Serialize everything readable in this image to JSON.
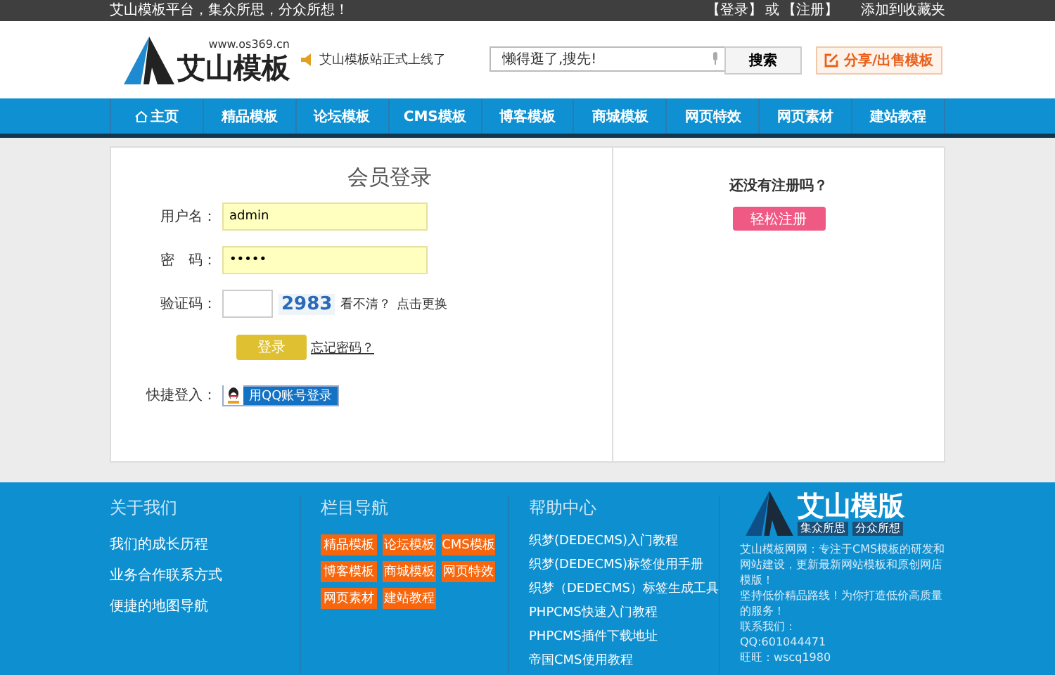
{
  "top_bar": {
    "slogan": "艾山模板平台，集众所思，分众所想！",
    "login": "【登录】",
    "or": "或",
    "register": "【注册】",
    "favorite": "添加到收藏夹"
  },
  "header": {
    "logo_text": "艾山模板",
    "logo_url": "www.os369.cn",
    "notice": "艾山模板站正式上线了",
    "search": {
      "value": "懒得逛了,搜先!",
      "button": "搜索"
    },
    "share_button": "分享/出售模板"
  },
  "nav": [
    {
      "label": "主页",
      "kind": "home"
    },
    {
      "label": "精品模板",
      "kind": "link"
    },
    {
      "label": "论坛模板",
      "kind": "link"
    },
    {
      "label": "CMS模板",
      "kind": "link"
    },
    {
      "label": "博客模板",
      "kind": "link"
    },
    {
      "label": "商城模板",
      "kind": "link"
    },
    {
      "label": "网页特效",
      "kind": "link"
    },
    {
      "label": "网页素材",
      "kind": "link"
    },
    {
      "label": "建站教程",
      "kind": "link"
    }
  ],
  "login": {
    "title": "会员登录",
    "username_label": "用户名：",
    "username": "admin",
    "password_label": "密　码：",
    "password": "•••••",
    "captcha_label": "验证码：",
    "captcha": "2983",
    "captcha_hint": "看不清？",
    "captcha_refresh": "点击更换",
    "submit": "登录",
    "forgot": "忘记密码？",
    "quick_label": "快捷登入：",
    "qq_button": "用QQ账号登录"
  },
  "register": {
    "question": "还没有注册吗？",
    "button": "轻松注册"
  },
  "footer": {
    "about": {
      "title": "关于我们",
      "links": [
        "我们的成长历程",
        "业务合作联系方式",
        "便捷的地图导航"
      ]
    },
    "categories": {
      "title": "栏目导航",
      "items": [
        "精品模板",
        "论坛模板",
        "CMS模板",
        "博客模板",
        "商城模板",
        "网页特效",
        "网页素材",
        "建站教程"
      ]
    },
    "help": {
      "title": "帮助中心",
      "links": [
        "织梦(DEDECMS)入门教程",
        "织梦(DEDECMS)标签使用手册",
        "织梦（DEDECMS）标签生成工具",
        "PHPCMS快速入门教程",
        "PHPCMS插件下载地址",
        "帝国CMS使用教程"
      ]
    },
    "brand": {
      "logo_text": "艾山模版",
      "tagline": [
        "集众所思",
        "分众所想"
      ],
      "lines": [
        "艾山模板网网：专注于CMS模板的研发和网站建设，更新最新网站模板和原创网店模版！",
        "坚持低价精品路线！为你打造低价高质量的服务！",
        "联系我们：",
        "QQ:601044471",
        "旺旺：wscq1980"
      ]
    }
  }
}
